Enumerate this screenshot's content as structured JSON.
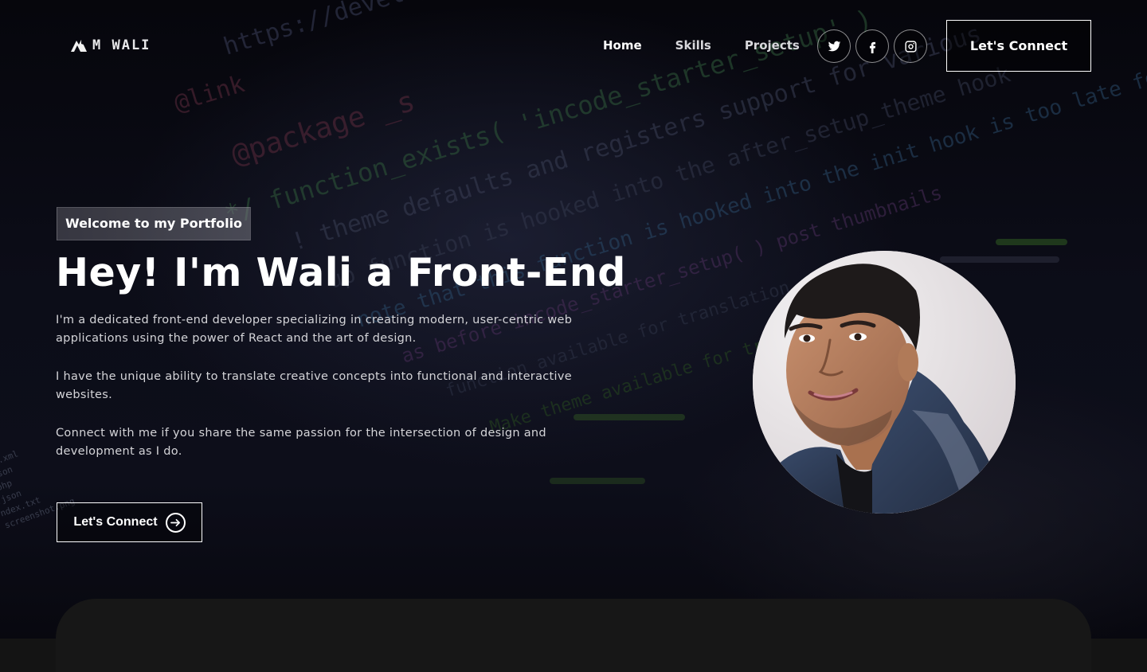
{
  "brand": {
    "logo_text": "M WALI",
    "logo_icon": "mountain-logo-icon"
  },
  "nav": {
    "items": [
      {
        "label": "Home"
      },
      {
        "label": "Skills"
      },
      {
        "label": "Projects"
      }
    ],
    "social": [
      {
        "icon": "twitter-icon"
      },
      {
        "icon": "facebook-icon"
      },
      {
        "icon": "instagram-icon"
      }
    ],
    "cta_label": "Let's Connect"
  },
  "hero": {
    "tagline": "Welcome to my Portfolio",
    "title": "Hey! I'm Wali a Front-End",
    "paragraphs": [
      "I'm a dedicated front-end developer specializing in creating modern, user-centric web applications using the power of React and the art of design.",
      "I have the unique ability to translate creative concepts into functional and interactive websites.",
      "Connect with me if you share the same passion for the intersection of design and development as I do."
    ],
    "cta_label": "Let's Connect",
    "cta_icon": "arrow-right-circle-icon"
  },
  "background_code": {
    "lines": [
      "https://developer",
      "@link",
      "@package _s",
      "*/ function_exists( 'incode_starter_setup' )",
      "! theme defaults and registers support for various",
      "up function is hooked into the after_setup_theme hook",
      "note that this function is hooked into the init hook is too late for some features",
      "as before incode_starter_setup( ) post thumbnails",
      "function available for translation",
      "Make theme available for translation"
    ],
    "side_text": [
      "txt.xml",
      ".json",
      ".php",
      ".json",
      "ndex.txt",
      "screenshot.png"
    ]
  },
  "colors": {
    "background": "#0a0a12",
    "text": "#ffffff",
    "muted_text": "#d4d4d8",
    "card": "#171717"
  }
}
